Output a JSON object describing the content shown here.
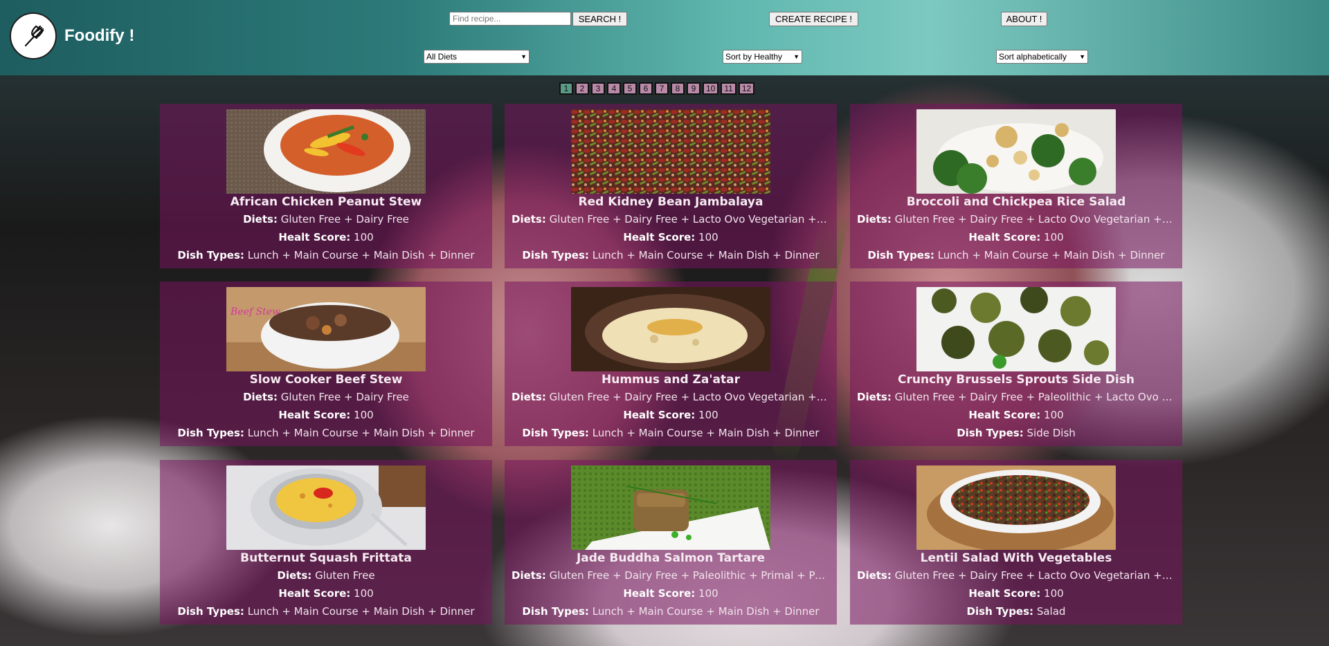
{
  "app": {
    "name": "Foodify !"
  },
  "header": {
    "search": {
      "placeholder": "Find recipe...",
      "button": "SEARCH !"
    },
    "create_button": "CREATE RECIPE !",
    "about_button": "ABOUT !"
  },
  "filters": {
    "diet": "All Diets",
    "sort_healthy": "Sort by Healthy",
    "sort_alpha": "Sort alphabetically"
  },
  "pagination": {
    "pages": [
      "1",
      "2",
      "3",
      "4",
      "5",
      "6",
      "7",
      "8",
      "9",
      "10",
      "11",
      "12"
    ],
    "current": "1"
  },
  "labels": {
    "diets": "Diets:",
    "score": "Healt Score:",
    "types": "Dish Types:"
  },
  "recipes": [
    {
      "title": "African Chicken Peanut Stew",
      "diets": "Gluten Free + Dairy Free",
      "score": "100",
      "types": "Lunch + Main Course + Main Dish + Dinner",
      "image": "stew-bowl"
    },
    {
      "title": "Red Kidney Bean Jambalaya",
      "diets": "Gluten Free + Dairy Free + Lacto Ovo Vegetarian + Ve...",
      "score": "100",
      "types": "Lunch + Main Course + Main Dish + Dinner",
      "image": "jambalaya"
    },
    {
      "title": "Broccoli and Chickpea Rice Salad",
      "diets": "Gluten Free + Dairy Free + Lacto Ovo Vegetarian + Ve...",
      "score": "100",
      "types": "Lunch + Main Course + Main Dish + Dinner",
      "image": "broccoli-salad"
    },
    {
      "title": "Slow Cooker Beef Stew",
      "diets": "Gluten Free + Dairy Free",
      "score": "100",
      "types": "Lunch + Main Course + Main Dish + Dinner",
      "image": "beef-stew",
      "image_caption": "Beef Stew"
    },
    {
      "title": "Hummus and Za'atar",
      "diets": "Gluten Free + Dairy Free + Lacto Ovo Vegetarian + Ve...",
      "score": "100",
      "types": "Lunch + Main Course + Main Dish + Dinner",
      "image": "hummus"
    },
    {
      "title": "Crunchy Brussels Sprouts Side Dish",
      "diets": "Gluten Free + Dairy Free + Paleolithic + Lacto Ovo Ve...",
      "score": "100",
      "types": "Side Dish",
      "image": "brussels-sprouts"
    },
    {
      "title": "Butternut Squash Frittata",
      "diets": "Gluten Free",
      "score": "100",
      "types": "Lunch + Main Course + Main Dish + Dinner",
      "image": "frittata"
    },
    {
      "title": "Jade Buddha Salmon Tartare",
      "diets": "Gluten Free + Dairy Free + Paleolithic + Primal + Pesc...",
      "score": "100",
      "types": "Lunch + Main Course + Main Dish + Dinner",
      "image": "salmon-tartare"
    },
    {
      "title": "Lentil Salad With Vegetables",
      "diets": "Gluten Free + Dairy Free + Lacto Ovo Vegetarian + W...",
      "score": "100",
      "types": "Salad",
      "image": "lentil-salad"
    }
  ]
}
